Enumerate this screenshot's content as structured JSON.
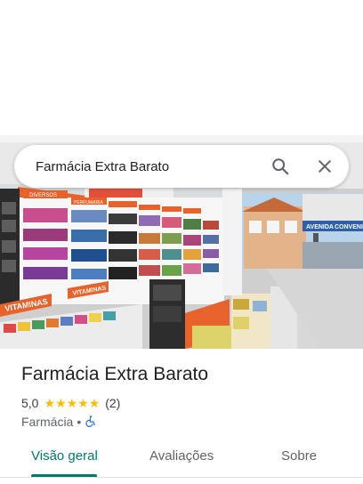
{
  "search": {
    "query": "Farmácia Extra Barato",
    "search_icon": "search-icon",
    "close_icon": "close-icon"
  },
  "place": {
    "name": "Farmácia Extra Barato",
    "rating": "5,0",
    "stars": "★★★★★",
    "rating_fraction": 1.0,
    "review_count": "(2)",
    "category": "Farmácia",
    "separator": "•",
    "accessibility_icon": "wheelchair-accessible-icon"
  },
  "photo": {
    "shelf_sign_1": "VITAMINAS",
    "shelf_sign_2": "VITAMINAS",
    "shelf_sign_3": "DIVERSOS",
    "shelf_sign_4": "PERFUMARIA",
    "store_sign_1": "AVENIDA",
    "store_sign_2": "CONVENIÊ"
  },
  "tabs": [
    {
      "label": "Visão geral",
      "active": true
    },
    {
      "label": "Avaliações",
      "active": false
    },
    {
      "label": "Sobre",
      "active": false
    }
  ],
  "colors": {
    "accent": "#00796b",
    "star": "#fbbc04",
    "shelf_orange": "#e8632b"
  }
}
